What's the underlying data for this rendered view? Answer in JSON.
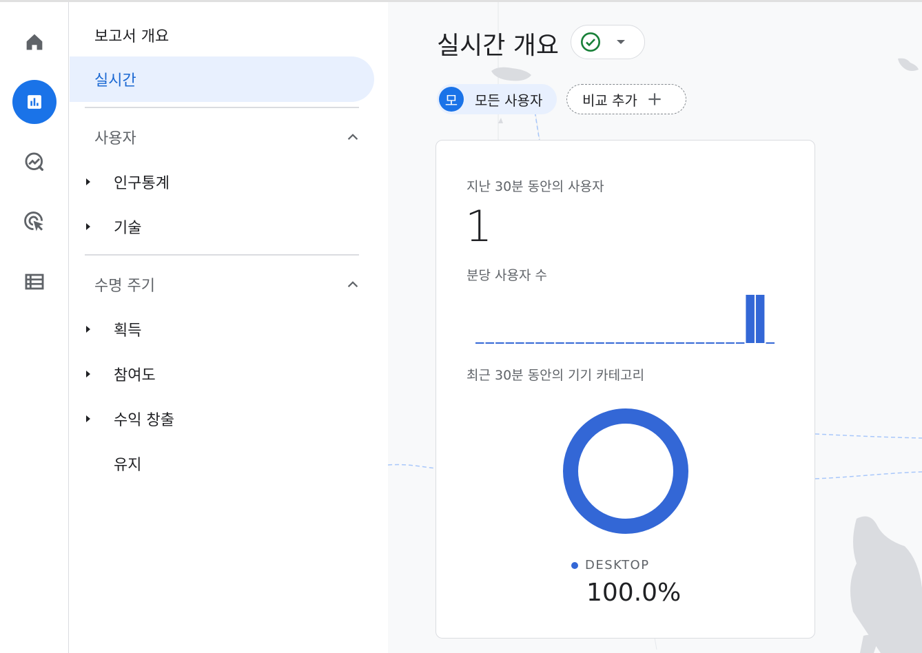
{
  "rail": {
    "items": [
      {
        "name": "home",
        "icon": "home-icon",
        "active": false
      },
      {
        "name": "reports",
        "icon": "bar-chart-icon",
        "active": true
      },
      {
        "name": "explore",
        "icon": "explore-trend-icon",
        "active": false
      },
      {
        "name": "advertising",
        "icon": "cursor-target-icon",
        "active": false
      },
      {
        "name": "configure",
        "icon": "list-icon",
        "active": false
      }
    ]
  },
  "nav": {
    "overview": "보고서 개요",
    "active_item": "실시간",
    "sections": [
      {
        "title": "사용자",
        "expanded": true,
        "items": [
          {
            "label": "인구통계",
            "has_children": true
          },
          {
            "label": "기술",
            "has_children": true
          }
        ]
      },
      {
        "title": "수명 주기",
        "expanded": true,
        "items": [
          {
            "label": "획득",
            "has_children": true
          },
          {
            "label": "참여도",
            "has_children": true
          },
          {
            "label": "수익 창출",
            "has_children": true
          },
          {
            "label": "유지",
            "has_children": false
          }
        ]
      }
    ]
  },
  "header": {
    "title": "실시간 개요",
    "status": "check-circle-icon"
  },
  "filters": {
    "all_users_avatar": "모",
    "all_users_label": "모든 사용자",
    "add_compare_label": "비교 추가"
  },
  "card": {
    "users_label": "지난 30분 동안의 사용자",
    "users_value": "1",
    "per_minute_label": "분당 사용자 수",
    "device_label": "최근 30분 동안의 기기 카테고리",
    "legend_label": "DESKTOP",
    "legend_value": "100.0%"
  },
  "colors": {
    "accent": "#1a73e8",
    "chart": "#3367d6",
    "active_nav_bg": "#e8f0fe",
    "success": "#188038"
  },
  "chart_data": [
    {
      "type": "bar",
      "title": "분당 사용자 수",
      "x": [
        -29,
        -28,
        -27,
        -26,
        -25,
        -24,
        -23,
        -22,
        -21,
        -20,
        -19,
        -18,
        -17,
        -16,
        -15,
        -14,
        -13,
        -12,
        -11,
        -10,
        -9,
        -8,
        -7,
        -6,
        -5,
        -4,
        -3,
        -2,
        -1,
        0
      ],
      "values": [
        0,
        0,
        0,
        0,
        0,
        0,
        0,
        0,
        0,
        0,
        0,
        0,
        0,
        0,
        0,
        0,
        0,
        0,
        0,
        0,
        0,
        0,
        0,
        0,
        0,
        0,
        0,
        1,
        1,
        0
      ],
      "ylim": [
        0,
        1
      ],
      "grid": false
    },
    {
      "type": "pie",
      "title": "최근 30분 동안의 기기 카테고리",
      "categories": [
        "DESKTOP"
      ],
      "values": [
        100.0
      ]
    }
  ]
}
